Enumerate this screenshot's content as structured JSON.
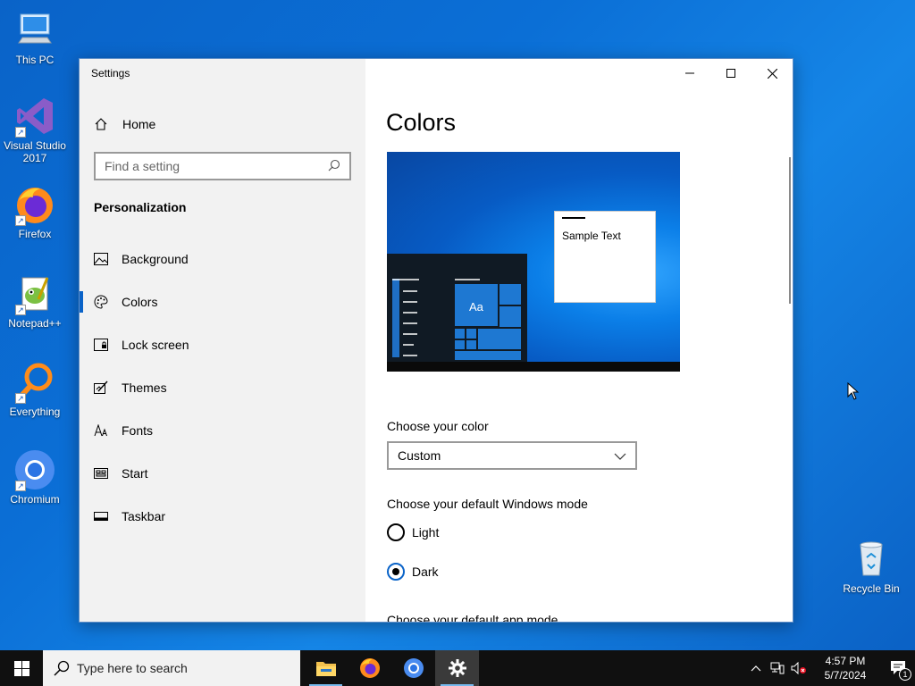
{
  "desktop": {
    "icons": [
      {
        "label": "This PC"
      },
      {
        "label": "Visual Studio 2017"
      },
      {
        "label": "Firefox"
      },
      {
        "label": "Notepad++"
      },
      {
        "label": "Everything"
      },
      {
        "label": "Chromium"
      },
      {
        "label": "Recycle Bin"
      }
    ]
  },
  "window": {
    "title": "Settings",
    "home_label": "Home",
    "search_placeholder": "Find a setting",
    "section": "Personalization",
    "nav": [
      {
        "label": "Background",
        "icon": "image-icon"
      },
      {
        "label": "Colors",
        "icon": "palette-icon",
        "active": true
      },
      {
        "label": "Lock screen",
        "icon": "lock-screen-icon"
      },
      {
        "label": "Themes",
        "icon": "themes-icon"
      },
      {
        "label": "Fonts",
        "icon": "fonts-icon"
      },
      {
        "label": "Start",
        "icon": "start-icon"
      },
      {
        "label": "Taskbar",
        "icon": "taskbar-icon"
      }
    ],
    "accent_color": "#0a63c8"
  },
  "content": {
    "title": "Colors",
    "preview": {
      "sample_text": "Sample Text",
      "tile_text": "Aa"
    },
    "choose_color_label": "Choose your color",
    "choose_color_value": "Custom",
    "mode_label": "Choose your default Windows mode",
    "modes": [
      {
        "label": "Light",
        "checked": false
      },
      {
        "label": "Dark",
        "checked": true
      }
    ],
    "app_mode_label": "Choose your default app mode"
  },
  "taskbar": {
    "search_placeholder": "Type here to search",
    "time": "4:57 PM",
    "date": "5/7/2024",
    "notification_count": "1"
  }
}
